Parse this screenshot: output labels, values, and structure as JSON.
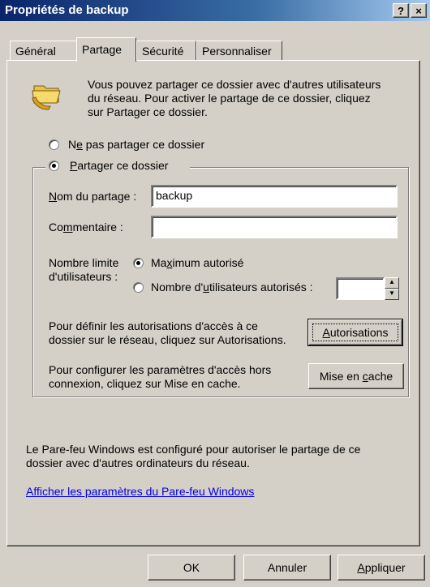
{
  "window": {
    "title": "Propriétés de backup",
    "help_glyph": "?",
    "close_glyph": "×"
  },
  "tabs": [
    {
      "label": "Général",
      "active": false
    },
    {
      "label": "Partage",
      "active": true
    },
    {
      "label": "Sécurité",
      "active": false
    },
    {
      "label": "Personnaliser",
      "active": false
    }
  ],
  "intro": {
    "line1": "Vous pouvez partager ce dossier avec d'autres utilisateurs",
    "line2": "du réseau. Pour activer le partage de ce dossier, cliquez",
    "line3": "sur Partager ce dossier.",
    "icon": "shared-folder-icon"
  },
  "share_options": {
    "no_share": {
      "pre": "N",
      "acc": "e",
      "post": " pas partager ce dossier",
      "selected": false
    },
    "share": {
      "acc": "P",
      "post": "artager ce dossier",
      "selected": true
    }
  },
  "share_name": {
    "label_acc": "N",
    "label_post": "om du partage :",
    "value": "backup"
  },
  "comment": {
    "label_pre": "Co",
    "label_acc": "m",
    "label_post": "mentaire :",
    "value": ""
  },
  "user_limit": {
    "label_line1": "Nombre limite",
    "label_line2": "d'utilisateurs :",
    "max_option": {
      "pre": "Ma",
      "acc": "x",
      "post": "imum autorisé",
      "selected": true
    },
    "count_option": {
      "pre": "Nombre d'",
      "acc": "u",
      "post": "tilisateurs autorisés :",
      "selected": false
    },
    "count_value": ""
  },
  "permissions": {
    "line1": "Pour définir les autorisations d'accès à ce",
    "line2": "dossier sur le réseau, cliquez sur Autorisations.",
    "button_acc": "A",
    "button_post": "utorisations"
  },
  "caching": {
    "line1": "Pour configurer les paramètres d'accès hors",
    "line2": "connexion, cliquez sur Mise en cache.",
    "button_pre": "Mise en ",
    "button_acc": "c",
    "button_post": "ache"
  },
  "firewall": {
    "line1": "Le Pare-feu Windows est configuré pour autoriser le partage de ce",
    "line2": "dossier avec d'autres ordinateurs du réseau.",
    "link": "Afficher les paramètres du Pare-feu Windows"
  },
  "footer": {
    "ok": "OK",
    "cancel": "Annuler",
    "apply_acc": "A",
    "apply_post": "ppliquer"
  },
  "colors": {
    "title_bar": "#0a246a",
    "face": "#d4d0c8",
    "link": "#0000ee"
  }
}
